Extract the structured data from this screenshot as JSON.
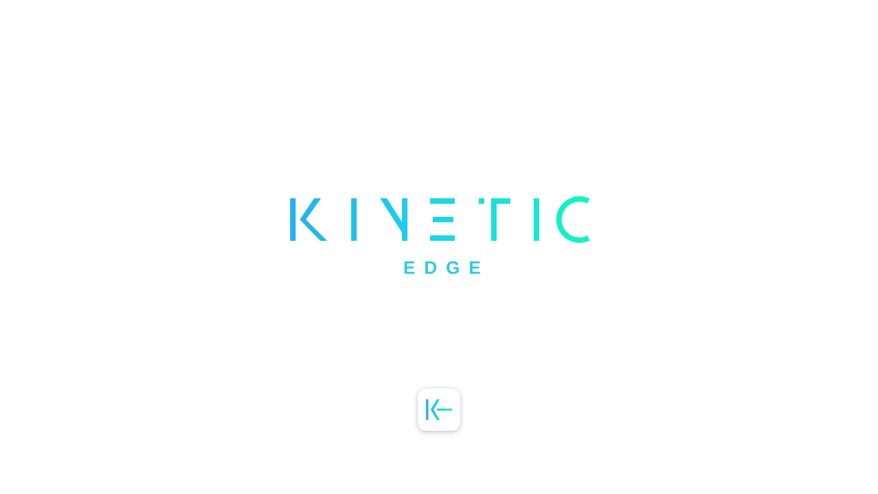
{
  "logo": {
    "wordmark": "KINETIC",
    "subtitle": "EDGE",
    "gradient_start": "#26b0f0",
    "gradient_mid": "#1ad6e8",
    "gradient_end": "#12f5c0",
    "subtitle_color": "#2cc9e8"
  },
  "app_icon": {
    "icon": "kinetic-k-arrow-icon",
    "background": "#ffffff"
  }
}
